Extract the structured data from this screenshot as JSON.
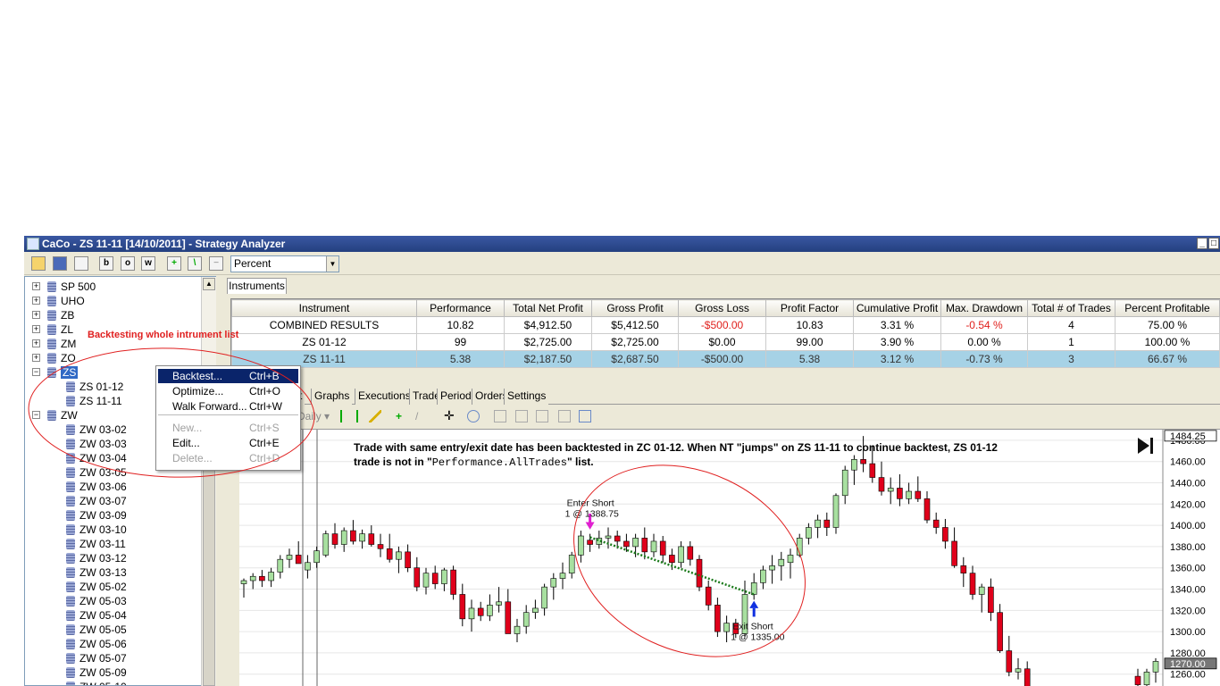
{
  "window": {
    "title": "CaCo - ZS 11-11 [14/10/2011] - Strategy Analyzer"
  },
  "toolbar": {
    "display_mode": "Percent"
  },
  "tree": [
    {
      "label": "SP 500",
      "expander": "+"
    },
    {
      "label": "UHO",
      "expander": "+"
    },
    {
      "label": "ZB",
      "expander": "+"
    },
    {
      "label": "ZL",
      "expander": "+"
    },
    {
      "label": "ZM",
      "expander": "+"
    },
    {
      "label": "ZO",
      "expander": "+"
    },
    {
      "label": "ZS",
      "expander": "−",
      "selected": true
    },
    {
      "label": "ZS 01-12",
      "child": true
    },
    {
      "label": "ZS 11-11",
      "child": true
    },
    {
      "label": "ZW",
      "expander": "−"
    },
    {
      "label": "ZW 03-02",
      "child": true
    },
    {
      "label": "ZW 03-03",
      "child": true
    },
    {
      "label": "ZW 03-04",
      "child": true
    },
    {
      "label": "ZW 03-05",
      "child": true
    },
    {
      "label": "ZW 03-06",
      "child": true
    },
    {
      "label": "ZW 03-07",
      "child": true
    },
    {
      "label": "ZW 03-09",
      "child": true
    },
    {
      "label": "ZW 03-10",
      "child": true
    },
    {
      "label": "ZW 03-11",
      "child": true
    },
    {
      "label": "ZW 03-12",
      "child": true
    },
    {
      "label": "ZW 03-13",
      "child": true
    },
    {
      "label": "ZW 05-02",
      "child": true
    },
    {
      "label": "ZW 05-03",
      "child": true
    },
    {
      "label": "ZW 05-04",
      "child": true
    },
    {
      "label": "ZW 05-05",
      "child": true
    },
    {
      "label": "ZW 05-06",
      "child": true
    },
    {
      "label": "ZW 05-07",
      "child": true
    },
    {
      "label": "ZW 05-09",
      "child": true
    },
    {
      "label": "ZW 05-10",
      "child": true
    }
  ],
  "context_menu": [
    {
      "label": "Backtest...",
      "shortcut": "Ctrl+B",
      "state": "active"
    },
    {
      "label": "Optimize...",
      "shortcut": "Ctrl+O",
      "state": "enabled"
    },
    {
      "label": "Walk Forward...",
      "shortcut": "Ctrl+W",
      "state": "enabled"
    },
    {
      "label": "New...",
      "shortcut": "Ctrl+S",
      "state": "disabled"
    },
    {
      "label": "Edit...",
      "shortcut": "Ctrl+E",
      "state": "enabled"
    },
    {
      "label": "Delete...",
      "shortcut": "Ctrl+D",
      "state": "disabled"
    }
  ],
  "notes": {
    "backtest_note": "Backtesting whole intrument list",
    "trade_note_line1": "Trade with same entry/exit date has been backtested in ZC 01-12. When NT \"jumps\" on ZS 11-11 to continue backtest, ZS 01-12",
    "trade_note_line2_prefix": "trade is not in \"",
    "trade_note_code": "Performance.AllTrades",
    "trade_note_line2_suffix": "\" list."
  },
  "instruments_tab": {
    "label": "Instruments"
  },
  "results": {
    "columns": [
      "Instrument",
      "Performance",
      "Total Net Profit",
      "Gross Profit",
      "Gross Loss",
      "Profit Factor",
      "Cumulative Profit",
      "Max. Drawdown",
      "Total # of Trades",
      "Percent Profitable"
    ],
    "rows": [
      [
        "COMBINED RESULTS",
        "10.82",
        "$4,912.50",
        "$5,412.50",
        "-$500.00",
        "10.83",
        "3.31 %",
        "-0.54 %",
        "4",
        "75.00 %"
      ],
      [
        "ZS 01-12",
        "99",
        "$2,725.00",
        "$2,725.00",
        "$0.00",
        "99.00",
        "3.90 %",
        "0.00 %",
        "1",
        "100.00 %"
      ],
      [
        "ZS 11-11",
        "5.38",
        "$2,187.50",
        "$2,687.50",
        "-$500.00",
        "5.38",
        "3.12 %",
        "-0.73 %",
        "3",
        "66.67 %"
      ]
    ]
  },
  "sub_tabs": [
    "t",
    "Graphs",
    "Executions",
    "Trades",
    "Periods",
    "Orders",
    "Settings"
  ],
  "chart_toolbar": {
    "period": "Daily"
  },
  "chart_data": {
    "type": "candlestick",
    "instrument": "ZS 11-11",
    "y_ticks": [
      1260,
      1280,
      1300,
      1320,
      1340,
      1360,
      1380,
      1400,
      1420,
      1440,
      1460,
      1480
    ],
    "y_range": [
      1248,
      1490
    ],
    "price_labels": {
      "high": "1484.25",
      "last": "1270.00"
    },
    "candles": [
      [
        1345,
        1350,
        1332,
        1348
      ],
      [
        1348,
        1355,
        1340,
        1352
      ],
      [
        1352,
        1358,
        1342,
        1348
      ],
      [
        1348,
        1360,
        1342,
        1356
      ],
      [
        1356,
        1372,
        1350,
        1368
      ],
      [
        1368,
        1378,
        1360,
        1372
      ],
      [
        1372,
        1385,
        1365,
        1364
      ],
      [
        1358,
        1372,
        1350,
        1365
      ],
      [
        1365,
        1380,
        1360,
        1376
      ],
      [
        1372,
        1395,
        1370,
        1392
      ],
      [
        1392,
        1402,
        1378,
        1382
      ],
      [
        1382,
        1398,
        1375,
        1395
      ],
      [
        1395,
        1405,
        1382,
        1385
      ],
      [
        1385,
        1396,
        1378,
        1392
      ],
      [
        1392,
        1400,
        1380,
        1382
      ],
      [
        1382,
        1392,
        1370,
        1378
      ],
      [
        1378,
        1392,
        1365,
        1368
      ],
      [
        1368,
        1380,
        1355,
        1375
      ],
      [
        1375,
        1382,
        1356,
        1360
      ],
      [
        1360,
        1370,
        1338,
        1342
      ],
      [
        1342,
        1360,
        1335,
        1355
      ],
      [
        1355,
        1362,
        1340,
        1345
      ],
      [
        1345,
        1360,
        1338,
        1358
      ],
      [
        1358,
        1362,
        1330,
        1335
      ],
      [
        1335,
        1345,
        1305,
        1312
      ],
      [
        1312,
        1330,
        1300,
        1322
      ],
      [
        1322,
        1328,
        1310,
        1315
      ],
      [
        1315,
        1335,
        1310,
        1325
      ],
      [
        1325,
        1342,
        1318,
        1328
      ],
      [
        1328,
        1340,
        1300,
        1298
      ],
      [
        1298,
        1312,
        1290,
        1305
      ],
      [
        1305,
        1325,
        1298,
        1318
      ],
      [
        1318,
        1330,
        1312,
        1322
      ],
      [
        1322,
        1345,
        1315,
        1342
      ],
      [
        1342,
        1355,
        1330,
        1350
      ],
      [
        1350,
        1365,
        1340,
        1355
      ],
      [
        1355,
        1375,
        1350,
        1372
      ],
      [
        1372,
        1395,
        1365,
        1390
      ],
      [
        1386,
        1392,
        1375,
        1382
      ],
      [
        1382,
        1395,
        1378,
        1388
      ],
      [
        1388,
        1398,
        1378,
        1390
      ],
      [
        1390,
        1395,
        1378,
        1385
      ],
      [
        1385,
        1392,
        1375,
        1380
      ],
      [
        1380,
        1392,
        1370,
        1388
      ],
      [
        1388,
        1398,
        1368,
        1375
      ],
      [
        1375,
        1392,
        1370,
        1385
      ],
      [
        1385,
        1390,
        1365,
        1372
      ],
      [
        1372,
        1378,
        1358,
        1365
      ],
      [
        1365,
        1385,
        1360,
        1380
      ],
      [
        1380,
        1385,
        1362,
        1368
      ],
      [
        1368,
        1372,
        1338,
        1342
      ],
      [
        1342,
        1348,
        1320,
        1325
      ],
      [
        1325,
        1332,
        1295,
        1300
      ],
      [
        1300,
        1315,
        1290,
        1308
      ],
      [
        1308,
        1312,
        1294,
        1298
      ],
      [
        1298,
        1348,
        1295,
        1335
      ],
      [
        1335,
        1355,
        1330,
        1346
      ],
      [
        1346,
        1362,
        1340,
        1358
      ],
      [
        1358,
        1372,
        1345,
        1362
      ],
      [
        1362,
        1375,
        1348,
        1368
      ],
      [
        1365,
        1378,
        1350,
        1372
      ],
      [
        1372,
        1392,
        1370,
        1388
      ],
      [
        1388,
        1402,
        1382,
        1398
      ],
      [
        1398,
        1410,
        1388,
        1405
      ],
      [
        1405,
        1412,
        1390,
        1398
      ],
      [
        1398,
        1430,
        1392,
        1428
      ],
      [
        1428,
        1456,
        1420,
        1452
      ],
      [
        1452,
        1466,
        1438,
        1462
      ],
      [
        1462,
        1484,
        1450,
        1458
      ],
      [
        1458,
        1475,
        1440,
        1445
      ],
      [
        1445,
        1460,
        1428,
        1432
      ],
      [
        1432,
        1445,
        1420,
        1435
      ],
      [
        1435,
        1448,
        1418,
        1425
      ],
      [
        1425,
        1440,
        1420,
        1432
      ],
      [
        1432,
        1446,
        1422,
        1425
      ],
      [
        1425,
        1432,
        1402,
        1405
      ],
      [
        1405,
        1412,
        1392,
        1398
      ],
      [
        1398,
        1406,
        1378,
        1385
      ],
      [
        1385,
        1398,
        1360,
        1362
      ],
      [
        1362,
        1370,
        1342,
        1355
      ],
      [
        1355,
        1362,
        1330,
        1335
      ],
      [
        1335,
        1345,
        1318,
        1342
      ],
      [
        1342,
        1350,
        1310,
        1318
      ],
      [
        1318,
        1326,
        1280,
        1282
      ],
      [
        1282,
        1296,
        1258,
        1262
      ],
      [
        1262,
        1275,
        1255,
        1265
      ],
      [
        1265,
        1272,
        1235,
        1238
      ]
    ],
    "last_candles": [
      [
        1258,
        1265,
        1245,
        1250
      ],
      [
        1250,
        1265,
        1240,
        1262
      ],
      [
        1262,
        1275,
        1252,
        1272
      ]
    ],
    "annotations": [
      {
        "text1": "Enter Short",
        "text2": "1 @ 1388.75"
      },
      {
        "text1": "Exit Short",
        "text2": "1 @ 1335.00"
      }
    ]
  },
  "colors": {
    "bull": "#a8e0a0",
    "bear": "#e0001b",
    "highlight_row": "#a6d2e6",
    "selection": "#0a246a",
    "annotation": "#e02020"
  }
}
